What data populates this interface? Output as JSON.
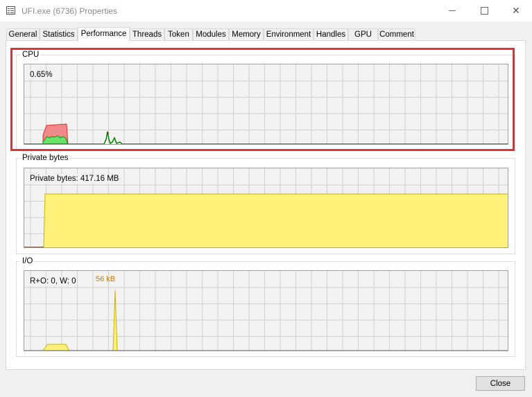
{
  "window": {
    "title": "UFI.exe (6736) Properties",
    "close_glyph": "✕"
  },
  "tabs": [
    {
      "label": "General"
    },
    {
      "label": "Statistics"
    },
    {
      "label": "Performance"
    },
    {
      "label": "Threads"
    },
    {
      "label": "Token"
    },
    {
      "label": "Modules"
    },
    {
      "label": "Memory"
    },
    {
      "label": "Environment"
    },
    {
      "label": "Handles"
    },
    {
      "label": "GPU"
    },
    {
      "label": "Comment"
    }
  ],
  "active_tab": "Performance",
  "cpu": {
    "group_label": "CPU",
    "readout": "0.65%",
    "kernel_color": "#ff0000",
    "total_color": "#00c000"
  },
  "private_bytes": {
    "group_label": "Private bytes",
    "readout": "Private bytes: 417.16 MB",
    "fill_color": "#fff17a",
    "line_color": "#c9b400"
  },
  "io": {
    "group_label": "I/O",
    "readout": "R+O: 0, W: 0",
    "peak_label": "56 kB",
    "peak_color": "#c97800"
  },
  "footer": {
    "close_label": "Close"
  },
  "highlight_color": "#e03234"
}
